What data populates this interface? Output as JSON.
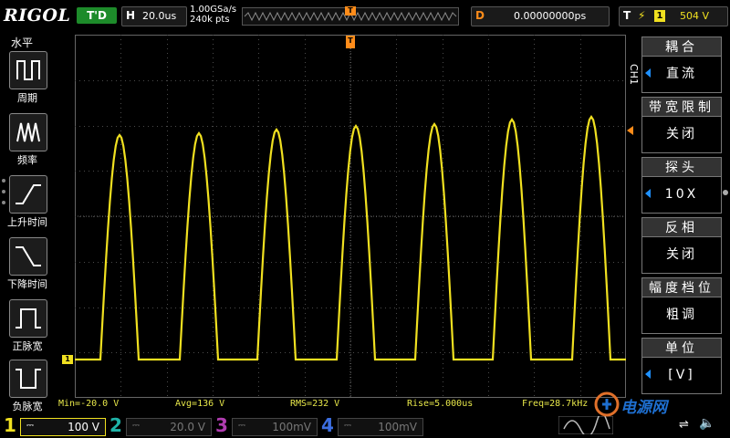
{
  "top": {
    "logo": "RIGOL",
    "run_state": "T'D",
    "horizontal": {
      "label": "H",
      "value": "20.0us"
    },
    "sample_rate": "1.00GSa/s",
    "memory_depth": "240k pts",
    "trigger_marker": "T",
    "delay": {
      "label": "D",
      "value": "0.00000000ps"
    },
    "trigger": {
      "label": "T",
      "source": "1",
      "level": "504 V"
    }
  },
  "left_menu": {
    "title": "水平",
    "items": [
      {
        "label": "周期",
        "icon": "period-icon"
      },
      {
        "label": "频率",
        "icon": "frequency-icon"
      },
      {
        "label": "上升时间",
        "icon": "rise-time-icon"
      },
      {
        "label": "下降时间",
        "icon": "fall-time-icon"
      },
      {
        "label": "正脉宽",
        "icon": "positive-width-icon"
      },
      {
        "label": "负脉宽",
        "icon": "negative-width-icon"
      }
    ]
  },
  "right_menu": {
    "channel_tag": "CH1",
    "items": [
      {
        "title": "耦合",
        "value": "直流"
      },
      {
        "title": "带宽限制",
        "value": "关闭"
      },
      {
        "title": "探头",
        "value": "10X"
      },
      {
        "title": "反相",
        "value": "关闭"
      },
      {
        "title": "幅度档位",
        "value": "粗调"
      },
      {
        "title": "单位",
        "value": "[V]"
      }
    ]
  },
  "screen": {
    "ch1_marker": "1"
  },
  "measurements": {
    "min": "Min=-20.0 V",
    "avg": "Avg=136 V",
    "rms": "RMS=232 V",
    "rise": "Rise=5.000us",
    "freq": "Freq=28.7kHz"
  },
  "channels": [
    {
      "num": "1",
      "value": "100 V",
      "color": "#f0e020",
      "active": true
    },
    {
      "num": "2",
      "value": "20.0 V",
      "color": "#1fb3a8",
      "active": false
    },
    {
      "num": "3",
      "value": "100mV",
      "color": "#b03cb0",
      "active": false
    },
    {
      "num": "4",
      "value": "100mV",
      "color": "#3c6ee0",
      "active": false
    }
  ],
  "watermark": "电源网",
  "colors": {
    "ch1": "#f0e020",
    "accent": "#1e90ff",
    "trigger": "#ff8c1a"
  }
}
